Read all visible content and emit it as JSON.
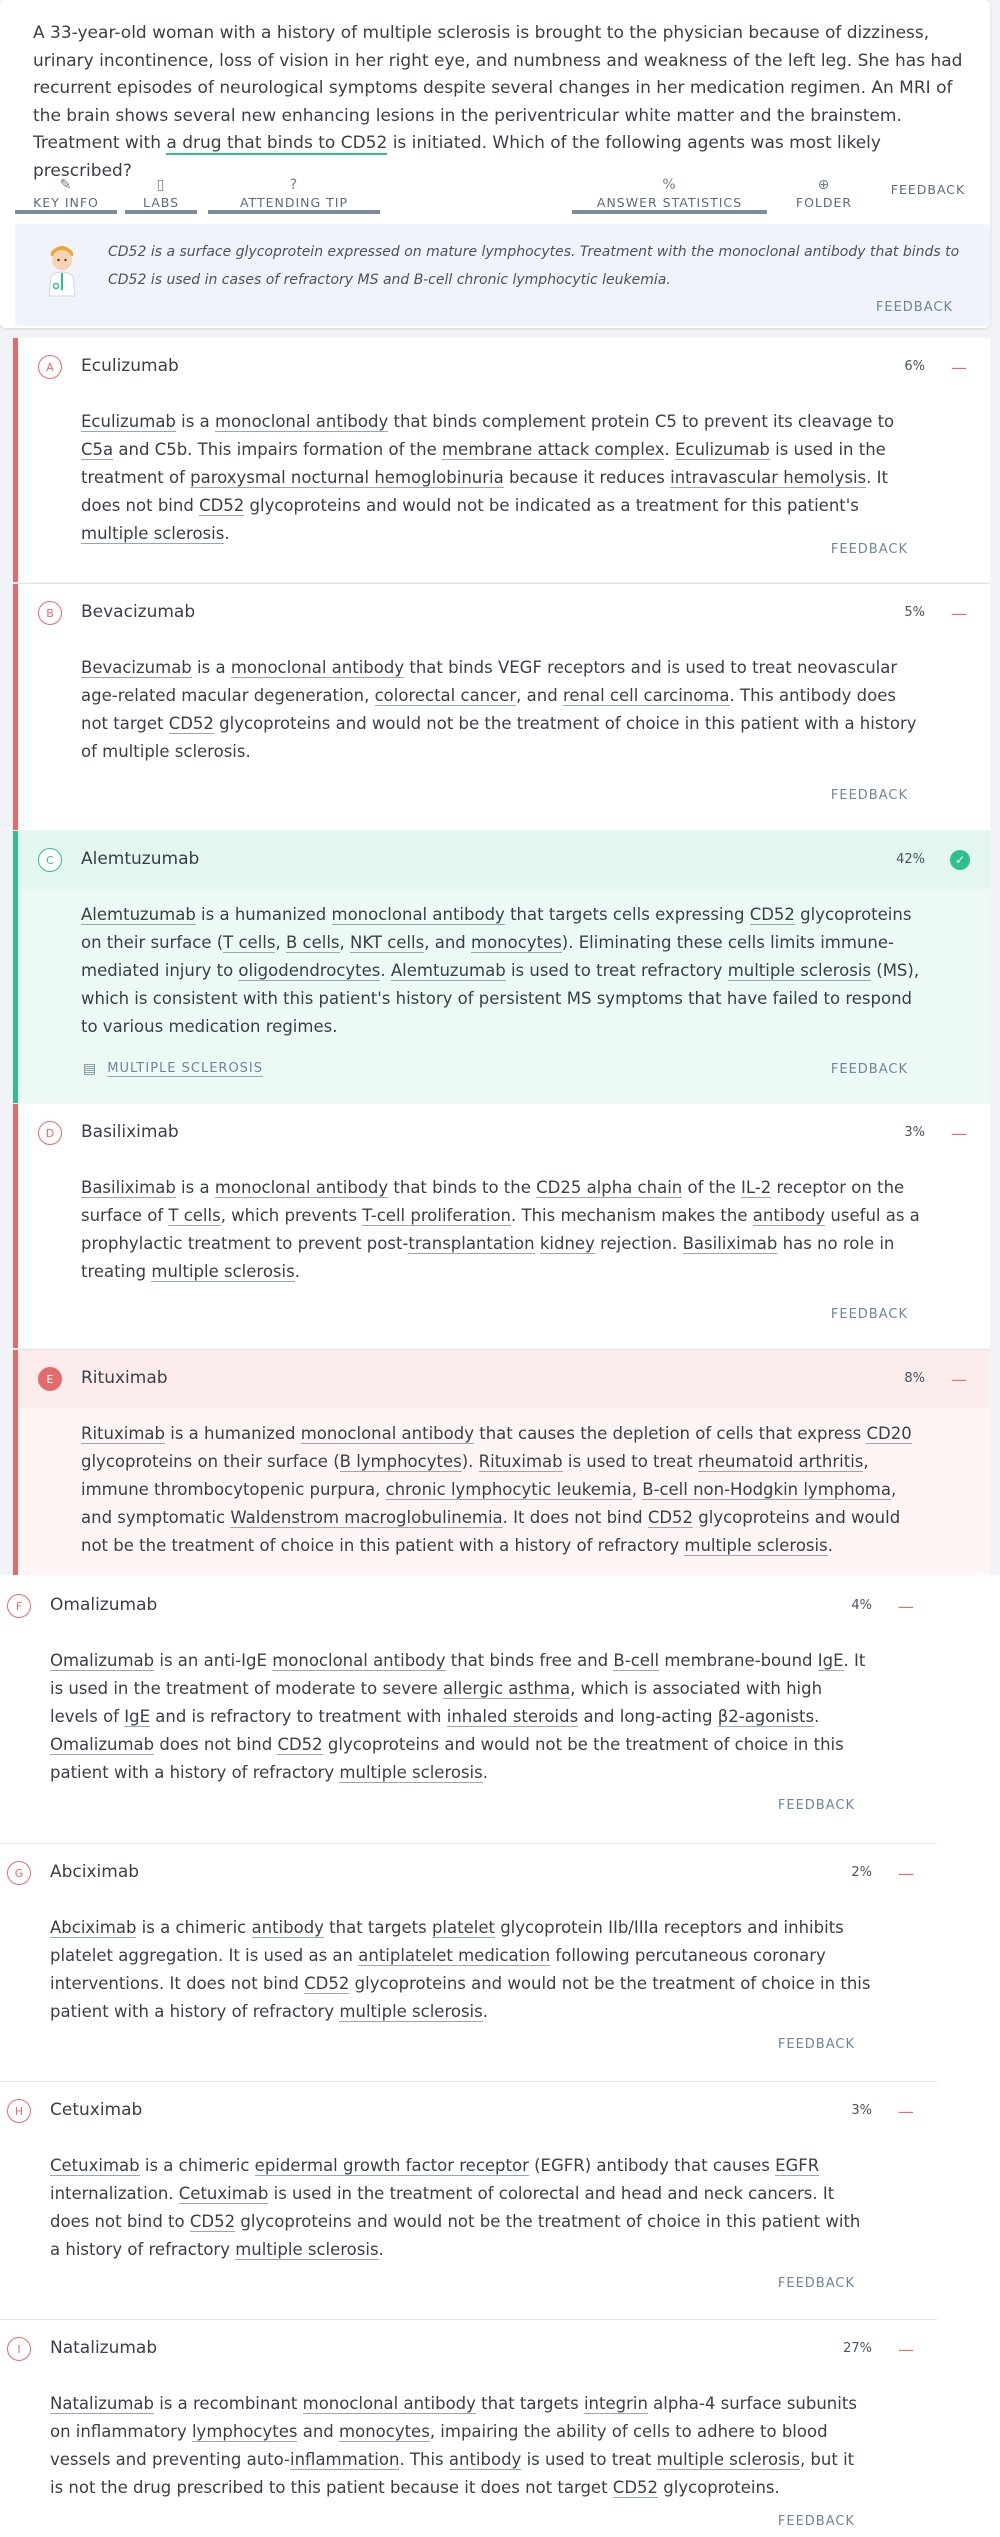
{
  "question": {
    "text_before": "A 33-year-old woman with a history of multiple sclerosis is brought to the physician because of dizziness, urinary incontinence, loss of vision in her right eye, and numbness and weakness of the left leg. She has had recurrent episodes of neurological symptoms despite several changes in her medication regimen. An MRI of the brain shows several new enhancing lesions in the periventricular white matter and the brainstem. Treatment with ",
    "highlight": "a drug that binds to CD52",
    "text_after": " is initiated. Which of the following agents was most likely prescribed?"
  },
  "toolbar": {
    "key_info": "KEY INFO",
    "labs": "LABS",
    "attending_tip": "ATTENDING TIP",
    "answer_statistics": "ANSWER STATISTICS",
    "folder": "FOLDER",
    "feedback": "FEEDBACK"
  },
  "tip": {
    "text": "CD52 is a surface glycoprotein expressed on mature lymphocytes. Treatment with the monoclonal antibody that binds to CD52 is used in cases of refractory MS and B-cell chronic lymphocytic leukemia.",
    "feedback": "FEEDBACK"
  },
  "feedback_label": "FEEDBACK",
  "topic_label": "MULTIPLE SCLEROSIS",
  "options": [
    {
      "letter": "A",
      "name": "Eculizumab",
      "pct": "6%"
    },
    {
      "letter": "B",
      "name": "Bevacizumab",
      "pct": "5%"
    },
    {
      "letter": "C",
      "name": "Alemtuzumab",
      "pct": "42%"
    },
    {
      "letter": "D",
      "name": "Basiliximab",
      "pct": "3%"
    },
    {
      "letter": "E",
      "name": "Rituximab",
      "pct": "8%"
    },
    {
      "letter": "F",
      "name": "Omalizumab",
      "pct": "4%"
    },
    {
      "letter": "G",
      "name": "Abciximab",
      "pct": "2%"
    },
    {
      "letter": "H",
      "name": "Cetuximab",
      "pct": "3%"
    },
    {
      "letter": "I",
      "name": "Natalizumab",
      "pct": "27%"
    }
  ],
  "explanations": {
    "A": [
      "Eculizumab",
      " is a ",
      "monoclonal antibody",
      " that binds complement protein C5 to prevent its cleavage to ",
      "C5a",
      " and C5b. This impairs formation of the ",
      "membrane attack complex",
      ". ",
      "Eculizumab",
      " is used in the treatment of ",
      "paroxysmal nocturnal hemoglobinuria",
      " because it reduces ",
      "intravascular hemolysis",
      ". It does not bind ",
      "CD52",
      " glycoproteins and would not be indicated as a treatment for this patient's ",
      "multiple sclerosis",
      "."
    ],
    "B": [
      "Bevacizumab",
      " is a ",
      "monoclonal antibody",
      " that binds VEGF receptors and is used to treat neovascular age-related macular degeneration, ",
      "colorectal cancer",
      ", and ",
      "renal cell carcinoma",
      ". This antibody does not target ",
      "CD52",
      " glycoproteins and would not be the treatment of choice in this patient with a history of multiple sclerosis."
    ],
    "C": [
      "Alemtuzumab",
      " is a humanized ",
      "monoclonal antibody",
      " that targets cells expressing ",
      "CD52",
      " glycoproteins on their surface (",
      "T cells",
      ", ",
      "B cells",
      ", ",
      "NKT cells",
      ", and ",
      "monocytes",
      "). Eliminating these cells limits immune-mediated injury to ",
      "oligodendrocytes",
      ". ",
      "Alemtuzumab",
      " is used to treat refractory ",
      "multiple sclerosis",
      " (MS), which is consistent with this patient's history of persistent MS symptoms that have failed to respond to various medication regimes."
    ],
    "D": [
      "Basiliximab",
      " is a ",
      "monoclonal antibody",
      " that binds to the ",
      "CD25 alpha chain",
      " of the ",
      "IL-2",
      " receptor on the surface of ",
      "T cells",
      ", which prevents ",
      "T-cell proliferation",
      ". This mechanism makes the ",
      "antibody",
      " useful as a prophylactic treatment to prevent post-",
      "transplantation",
      " ",
      "kidney",
      " rejection. ",
      "Basiliximab",
      " has no role in treating ",
      "multiple sclerosis",
      "."
    ],
    "E": [
      "Rituximab",
      " is a humanized ",
      "monoclonal antibody",
      " that causes the depletion of cells that express ",
      "CD20",
      " glycoproteins on their surface (",
      "B lymphocytes",
      "). ",
      "Rituximab",
      " is used to treat ",
      "rheumatoid arthritis",
      ", immune thrombocytopenic purpura, ",
      "chronic lymphocytic leukemia",
      ", ",
      "B-cell non-Hodgkin lymphoma",
      ", and symptomatic ",
      "Waldenstrom macroglobulinemia",
      ". It does not bind ",
      "CD52",
      " glycoproteins and would not be the treatment of choice in this patient with a history of refractory ",
      "multiple sclerosis",
      "."
    ],
    "F": [
      "Omalizumab",
      " is an anti-IgE ",
      "monoclonal antibody",
      " that binds free and ",
      "B-cell",
      " membrane-bound ",
      "IgE",
      ". It is used in the treatment of moderate to severe ",
      "allergic asthma",
      ", which is associated with high levels of ",
      "IgE",
      " and is refractory to treatment with ",
      "inhaled steroids",
      " and long-acting ",
      "β2-agonists",
      ". ",
      "Omalizumab",
      " does not bind ",
      "CD52",
      " glycoproteins and would not be the treatment of choice in this patient with a history of refractory ",
      "multiple sclerosis",
      "."
    ],
    "G": [
      "Abciximab",
      " is a chimeric ",
      "antibody",
      " that targets ",
      "platelet",
      " glycoprotein IIb/IIIa receptors and inhibits platelet aggregation. It is used as an ",
      "antiplatelet medication",
      " following percutaneous coronary interventions. It does not bind ",
      "CD52",
      " glycoproteins and would not be the treatment of choice in this patient with a history of refractory ",
      "multiple sclerosis",
      "."
    ],
    "H": [
      "Cetuximab",
      " is a chimeric ",
      "epidermal growth factor receptor",
      " (EGFR) antibody that causes ",
      "EGFR",
      " internalization. ",
      "Cetuximab",
      " is used in the treatment of colorectal and head and neck cancers. It does not bind to ",
      "CD52",
      " glycoproteins and would not be the treatment of choice in this patient with a history of refractory ",
      "multiple sclerosis",
      "."
    ],
    "I": [
      "Natalizumab",
      " is a recombinant ",
      "monoclonal antibody",
      " that targets ",
      "integrin",
      " alpha-4 surface subunits on inflammatory ",
      "lymphocytes",
      " and ",
      "monocytes",
      ", impairing the ability of cells to adhere to blood vessels and preventing auto-",
      "inflammation",
      ". This ",
      "antibody",
      " is used to treat ",
      "multiple sclerosis",
      ", but it is not the drug prescribed to this patient because it does not target ",
      "CD52",
      " glycoproteins."
    ]
  }
}
